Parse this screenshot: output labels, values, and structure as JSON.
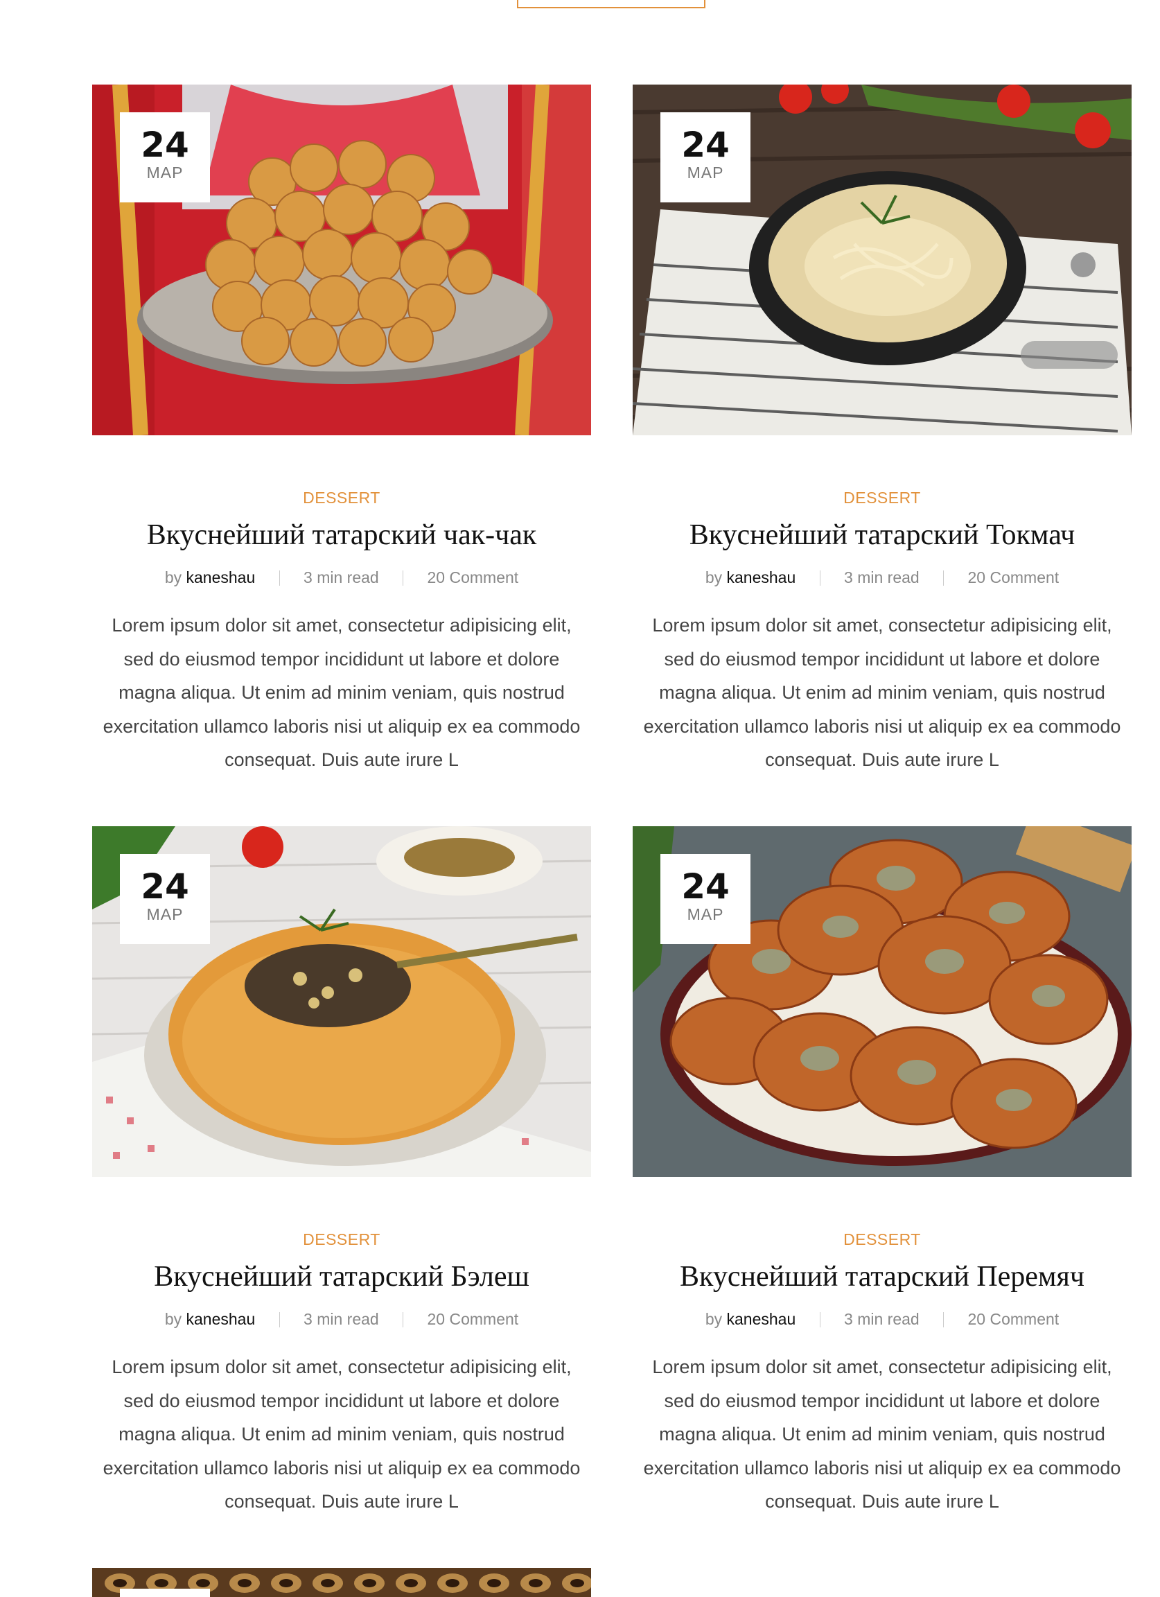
{
  "cards": [
    {
      "date": {
        "day": "24",
        "month": "MAP"
      },
      "category": "DESSERT",
      "title": "Вкуснейший татарский чак-чак",
      "meta": {
        "by": "by",
        "author": "kaneshau",
        "read": "3 min read",
        "comments": "20 Comment"
      },
      "excerpt": "Lorem ipsum dolor sit amet, consectetur adipisicing elit, sed do eiusmod tempor incididunt ut labore et dolore magna aliqua. Ut enim ad minim veniam, quis nostrud exercitation ullamco laboris nisi ut aliquip ex ea commodo consequat. Duis aute irure L"
    },
    {
      "date": {
        "day": "24",
        "month": "MAP"
      },
      "category": "DESSERT",
      "title": "Вкуснейший татарский Токмач",
      "meta": {
        "by": "by",
        "author": "kaneshau",
        "read": "3 min read",
        "comments": "20 Comment"
      },
      "excerpt": "Lorem ipsum dolor sit amet, consectetur adipisicing elit, sed do eiusmod tempor incididunt ut labore et dolore magna aliqua. Ut enim ad minim veniam, quis nostrud exercitation ullamco laboris nisi ut aliquip ex ea commodo consequat. Duis aute irure L"
    },
    {
      "date": {
        "day": "24",
        "month": "MAP"
      },
      "category": "DESSERT",
      "title": "Вкуснейший татарский Бэлеш",
      "meta": {
        "by": "by",
        "author": "kaneshau",
        "read": "3 min read",
        "comments": "20 Comment"
      },
      "excerpt": "Lorem ipsum dolor sit amet, consectetur adipisicing elit, sed do eiusmod tempor incididunt ut labore et dolore magna aliqua. Ut enim ad minim veniam, quis nostrud exercitation ullamco laboris nisi ut aliquip ex ea commodo consequat. Duis aute irure L"
    },
    {
      "date": {
        "day": "24",
        "month": "MAP"
      },
      "category": "DESSERT",
      "title": "Вкуснейший татарский Перемяч",
      "meta": {
        "by": "by",
        "author": "kaneshau",
        "read": "3 min read",
        "comments": "20 Comment"
      },
      "excerpt": "Lorem ipsum dolor sit amet, consectetur adipisicing elit, sed do eiusmod tempor incididunt ut labore et dolore magna aliqua. Ut enim ad minim veniam, quis nostrud exercitation ullamco laboris nisi ut aliquip ex ea commodo consequat. Duis aute irure L"
    }
  ],
  "colors": {
    "accent": "#e2913b",
    "title": "#111111",
    "meta": "#888888",
    "body": "#444444"
  }
}
